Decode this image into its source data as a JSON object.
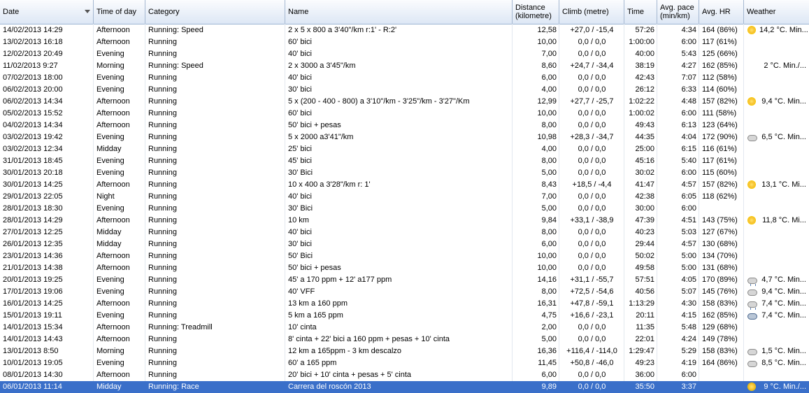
{
  "columns": {
    "date": "Date",
    "time_of_day": "Time of day",
    "category": "Category",
    "name": "Name",
    "distance_line1": "Distance",
    "distance_line2": "(kilometre)",
    "climb": "Climb (metre)",
    "time": "Time",
    "pace_line1": "Avg. pace",
    "pace_line2": "(min/km)",
    "hr": "Avg. HR",
    "weather": "Weather"
  },
  "rows": [
    {
      "date": "14/02/2013 14:29",
      "tod": "Afternoon",
      "cat": "Running: Speed",
      "name": "2 x 5 x 800 a 3'40\"/km r:1' - R:2'",
      "dist": "12,58",
      "climb": "+27,0 / -15,4",
      "time": "57:26",
      "pace": "4:34",
      "hr": "164 (86%)",
      "wicon": "sun-icon",
      "weather": "14,2 °C. Min..."
    },
    {
      "date": "13/02/2013 16:18",
      "tod": "Afternoon",
      "cat": "Running",
      "name": "60' bici",
      "dist": "10,00",
      "climb": "0,0 / 0,0",
      "time": "1:00:00",
      "pace": "6:00",
      "hr": "117 (61%)",
      "wicon": "",
      "weather": ""
    },
    {
      "date": "12/02/2013 20:49",
      "tod": "Evening",
      "cat": "Running",
      "name": "40' bici",
      "dist": "7,00",
      "climb": "0,0 / 0,0",
      "time": "40:00",
      "pace": "5:43",
      "hr": "125 (66%)",
      "wicon": "",
      "weather": ""
    },
    {
      "date": "11/02/2013 9:27",
      "tod": "Morning",
      "cat": "Running: Speed",
      "name": "2 x 3000 a 3'45\"/km",
      "dist": "8,60",
      "climb": "+24,7 / -34,4",
      "time": "38:19",
      "pace": "4:27",
      "hr": "162 (85%)",
      "wicon": "",
      "weather": "2 °C. Min./..."
    },
    {
      "date": "07/02/2013 18:00",
      "tod": "Evening",
      "cat": "Running",
      "name": "40' bici",
      "dist": "6,00",
      "climb": "0,0 / 0,0",
      "time": "42:43",
      "pace": "7:07",
      "hr": "112 (58%)",
      "wicon": "",
      "weather": ""
    },
    {
      "date": "06/02/2013 20:00",
      "tod": "Evening",
      "cat": "Running",
      "name": "30' bici",
      "dist": "4,00",
      "climb": "0,0 / 0,0",
      "time": "26:12",
      "pace": "6:33",
      "hr": "114 (60%)",
      "wicon": "",
      "weather": ""
    },
    {
      "date": "06/02/2013 14:34",
      "tod": "Afternoon",
      "cat": "Running",
      "name": "5 x (200 - 400 - 800) a 3'10\"/km - 3'25\"/km - 3'27\"/Km",
      "dist": "12,99",
      "climb": "+27,7 / -25,7",
      "time": "1:02:22",
      "pace": "4:48",
      "hr": "157 (82%)",
      "wicon": "sun-icon",
      "weather": "9,4 °C. Min..."
    },
    {
      "date": "05/02/2013 15:52",
      "tod": "Afternoon",
      "cat": "Running",
      "name": "60' bici",
      "dist": "10,00",
      "climb": "0,0 / 0,0",
      "time": "1:00:02",
      "pace": "6:00",
      "hr": "111 (58%)",
      "wicon": "",
      "weather": ""
    },
    {
      "date": "04/02/2013 14:34",
      "tod": "Afternoon",
      "cat": "Running",
      "name": "50' bici + pesas",
      "dist": "8,00",
      "climb": "0,0 / 0,0",
      "time": "49:43",
      "pace": "6:13",
      "hr": "123 (64%)",
      "wicon": "",
      "weather": ""
    },
    {
      "date": "03/02/2013 19:42",
      "tod": "Evening",
      "cat": "Running",
      "name": "5 x 2000 a3'41\"/km",
      "dist": "10,98",
      "climb": "+28,3 / -34,7",
      "time": "44:35",
      "pace": "4:04",
      "hr": "172 (90%)",
      "wicon": "cloud-icon",
      "weather": "6,5 °C. Min..."
    },
    {
      "date": "03/02/2013 12:34",
      "tod": "Midday",
      "cat": "Running",
      "name": "25' bici",
      "dist": "4,00",
      "climb": "0,0 / 0,0",
      "time": "25:00",
      "pace": "6:15",
      "hr": "116 (61%)",
      "wicon": "",
      "weather": ""
    },
    {
      "date": "31/01/2013 18:45",
      "tod": "Evening",
      "cat": "Running",
      "name": "45' bici",
      "dist": "8,00",
      "climb": "0,0 / 0,0",
      "time": "45:16",
      "pace": "5:40",
      "hr": "117 (61%)",
      "wicon": "",
      "weather": ""
    },
    {
      "date": "30/01/2013 20:18",
      "tod": "Evening",
      "cat": "Running",
      "name": "30' Bici",
      "dist": "5,00",
      "climb": "0,0 / 0,0",
      "time": "30:02",
      "pace": "6:00",
      "hr": "115 (60%)",
      "wicon": "",
      "weather": ""
    },
    {
      "date": "30/01/2013 14:25",
      "tod": "Afternoon",
      "cat": "Running",
      "name": "10 x 400 a 3'28\"/km r: 1'",
      "dist": "8,43",
      "climb": "+18,5 / -4,4",
      "time": "41:47",
      "pace": "4:57",
      "hr": "157 (82%)",
      "wicon": "sun-icon",
      "weather": "13,1 °C. Mi..."
    },
    {
      "date": "29/01/2013 22:05",
      "tod": "Night",
      "cat": "Running",
      "name": "40' bici",
      "dist": "7,00",
      "climb": "0,0 / 0,0",
      "time": "42:38",
      "pace": "6:05",
      "hr": "118 (62%)",
      "wicon": "",
      "weather": ""
    },
    {
      "date": "28/01/2013 18:30",
      "tod": "Evening",
      "cat": "Running",
      "name": "30' Bici",
      "dist": "5,00",
      "climb": "0,0 / 0,0",
      "time": "30:00",
      "pace": "6:00",
      "hr": "",
      "wicon": "",
      "weather": ""
    },
    {
      "date": "28/01/2013 14:29",
      "tod": "Afternoon",
      "cat": "Running",
      "name": "10 km",
      "dist": "9,84",
      "climb": "+33,1 / -38,9",
      "time": "47:39",
      "pace": "4:51",
      "hr": "143 (75%)",
      "wicon": "sun-icon",
      "weather": "11,8 °C. Mi..."
    },
    {
      "date": "27/01/2013 12:25",
      "tod": "Midday",
      "cat": "Running",
      "name": "40' bici",
      "dist": "8,00",
      "climb": "0,0 / 0,0",
      "time": "40:23",
      "pace": "5:03",
      "hr": "127 (67%)",
      "wicon": "",
      "weather": ""
    },
    {
      "date": "26/01/2013 12:35",
      "tod": "Midday",
      "cat": "Running",
      "name": "30' bici",
      "dist": "6,00",
      "climb": "0,0 / 0,0",
      "time": "29:44",
      "pace": "4:57",
      "hr": "130 (68%)",
      "wicon": "",
      "weather": ""
    },
    {
      "date": "23/01/2013 14:36",
      "tod": "Afternoon",
      "cat": "Running",
      "name": "50' Bici",
      "dist": "10,00",
      "climb": "0,0 / 0,0",
      "time": "50:02",
      "pace": "5:00",
      "hr": "134 (70%)",
      "wicon": "",
      "weather": ""
    },
    {
      "date": "21/01/2013 14:38",
      "tod": "Afternoon",
      "cat": "Running",
      "name": "50' bici + pesas",
      "dist": "10,00",
      "climb": "0,0 / 0,0",
      "time": "49:58",
      "pace": "5:00",
      "hr": "131 (68%)",
      "wicon": "",
      "weather": ""
    },
    {
      "date": "20/01/2013 19:25",
      "tod": "Evening",
      "cat": "Running",
      "name": "45' a 170 ppm + 12' a177 ppm",
      "dist": "14,16",
      "climb": "+31,1 / -55,7",
      "time": "57:51",
      "pace": "4:05",
      "hr": "170 (89%)",
      "wicon": "rain-icon",
      "weather": "4,7 °C. Min..."
    },
    {
      "date": "17/01/2013 19:06",
      "tod": "Evening",
      "cat": "Running",
      "name": "40' VFF",
      "dist": "8,00",
      "climb": "+72,5 / -54,6",
      "time": "40:56",
      "pace": "5:07",
      "hr": "145 (76%)",
      "wicon": "cloud-icon",
      "weather": "9,4 °C. Min..."
    },
    {
      "date": "16/01/2013 14:25",
      "tod": "Afternoon",
      "cat": "Running",
      "name": "13 km a 160 ppm",
      "dist": "16,31",
      "climb": "+47,8 / -59,1",
      "time": "1:13:29",
      "pace": "4:30",
      "hr": "158 (83%)",
      "wicon": "rain-icon",
      "weather": "7,4 °C. Min..."
    },
    {
      "date": "15/01/2013 19:11",
      "tod": "Evening",
      "cat": "Running",
      "name": "5 km a 165 ppm",
      "dist": "4,75",
      "climb": "+16,6 / -23,1",
      "time": "20:11",
      "pace": "4:15",
      "hr": "162 (85%)",
      "wicon": "storm-icon",
      "weather": "7,4 °C. Min..."
    },
    {
      "date": "14/01/2013 15:34",
      "tod": "Afternoon",
      "cat": "Running: Treadmill",
      "name": "10' cinta",
      "dist": "2,00",
      "climb": "0,0 / 0,0",
      "time": "11:35",
      "pace": "5:48",
      "hr": "129 (68%)",
      "wicon": "",
      "weather": ""
    },
    {
      "date": "14/01/2013 14:43",
      "tod": "Afternoon",
      "cat": "Running",
      "name": "8' cinta + 22' bici a 160 ppm + pesas + 10' cinta",
      "dist": "5,00",
      "climb": "0,0 / 0,0",
      "time": "22:01",
      "pace": "4:24",
      "hr": "149 (78%)",
      "wicon": "",
      "weather": ""
    },
    {
      "date": "13/01/2013 8:50",
      "tod": "Morning",
      "cat": "Running",
      "name": "12 km a 165ppm - 3 km descalzo",
      "dist": "16,36",
      "climb": "+116,4 / -114,0",
      "time": "1:29:47",
      "pace": "5:29",
      "hr": "158 (83%)",
      "wicon": "cloud-icon",
      "weather": "1,5 °C. Min..."
    },
    {
      "date": "10/01/2013 19:05",
      "tod": "Evening",
      "cat": "Running",
      "name": "60' a 165 ppm",
      "dist": "11,45",
      "climb": "+50,8 / -46,0",
      "time": "49:23",
      "pace": "4:19",
      "hr": "164 (86%)",
      "wicon": "cloud-icon",
      "weather": "8,5 °C. Min..."
    },
    {
      "date": "08/01/2013 14:30",
      "tod": "Afternoon",
      "cat": "Running",
      "name": "20' bici + 10' cinta + pesas + 5' cinta",
      "dist": "6,00",
      "climb": "0,0 / 0,0",
      "time": "36:00",
      "pace": "6:00",
      "hr": "",
      "wicon": "",
      "weather": ""
    },
    {
      "date": "06/01/2013 11:14",
      "tod": "Midday",
      "cat": "Running: Race",
      "name": "Carrera del roscón 2013",
      "dist": "9,89",
      "climb": "0,0 / 0,0",
      "time": "35:50",
      "pace": "3:37",
      "hr": "",
      "wicon": "sun-icon",
      "weather": "9 °C. Min./..."
    }
  ],
  "selected_row_index": 30,
  "colors": {
    "selection": "#3a6fc9",
    "header_top": "#fbfcfe",
    "header_bottom": "#dde7f5"
  }
}
